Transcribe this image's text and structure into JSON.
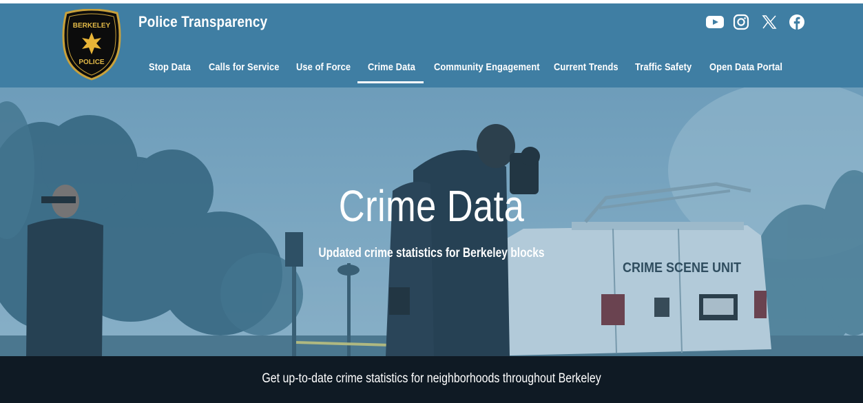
{
  "header": {
    "badge_top_text": "BERKELEY",
    "badge_bottom_text": "POLICE",
    "site_title": "Police Transparency",
    "social_icons": [
      "youtube-icon",
      "instagram-icon",
      "x-icon",
      "facebook-icon"
    ],
    "background_color": "#3f7ea3"
  },
  "nav": {
    "items": [
      {
        "label": "Stop Data"
      },
      {
        "label": "Calls for Service"
      },
      {
        "label": "Use of Force"
      },
      {
        "label": "Crime Data",
        "active": true
      },
      {
        "label": "Community Engagement"
      },
      {
        "label": "Current Trends"
      },
      {
        "label": "Traffic Safety"
      },
      {
        "label": "Open Data Portal"
      }
    ]
  },
  "hero": {
    "title": "Crime Data",
    "subtitle": "Updated crime statistics for Berkeley blocks",
    "van_text": "CRIME SCENE UNIT"
  },
  "band": {
    "text": "Get up-to-date crime statistics for neighborhoods throughout Berkeley",
    "background_color": "#0f1a24"
  }
}
